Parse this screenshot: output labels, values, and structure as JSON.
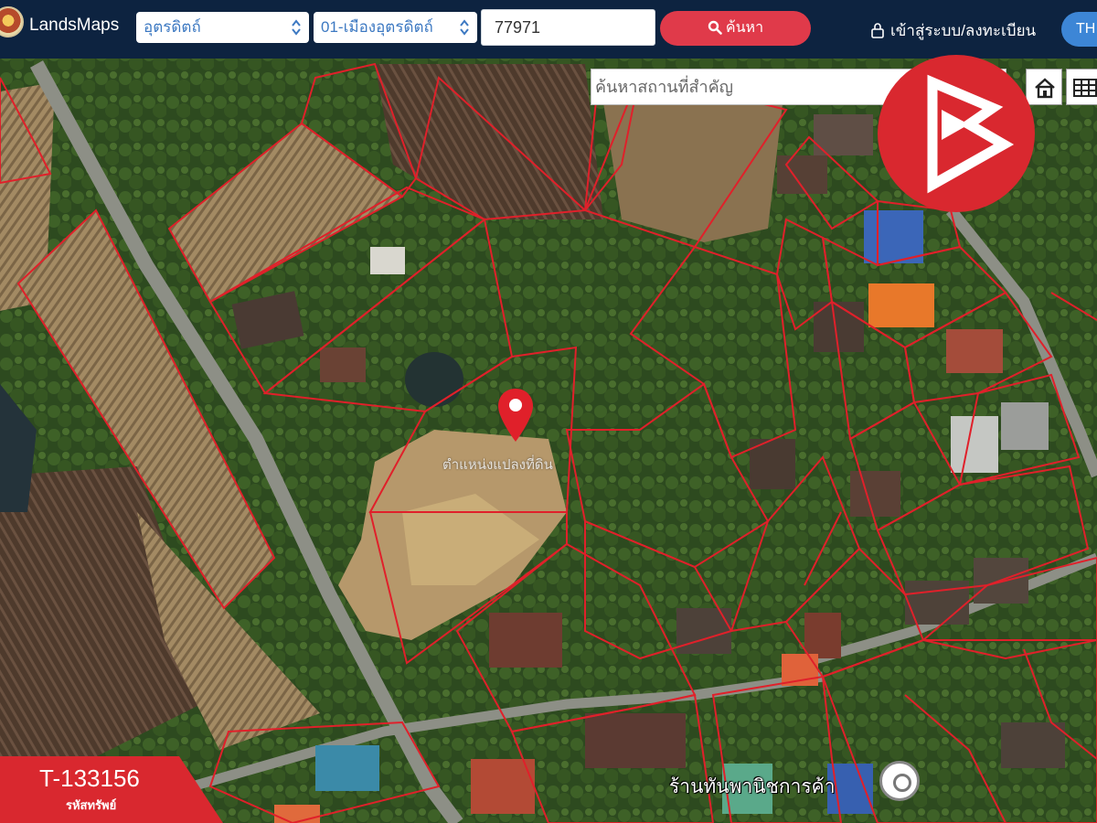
{
  "header": {
    "app_name": "LandsMaps",
    "province": "อุตรดิตถ์",
    "district": "01-เมืองอุตรดิตถ์",
    "parcel_number": "77971",
    "search_label": "ค้นหา",
    "login_label": "เข้าสู่ระบบ/ลงทะเบียน",
    "language": "TH"
  },
  "map": {
    "place_search_placeholder": "ค้นหาสถานที่สำคัญ",
    "clear_symbol": "×",
    "pin_label": "ตำแหน่งแปลงที่ดิน",
    "shop_label": "ร้านทันพานิชการค้า",
    "parcel_line_color": "#e0202a",
    "pin_color": "#e0202a"
  },
  "listing": {
    "code": "T-133156",
    "code_caption": "รหัสทรัพย์",
    "badge_color": "#d9282f"
  },
  "icons": [
    "search-icon",
    "lock-icon",
    "home-icon",
    "grid-icon",
    "location-pin-icon",
    "brand-logo-icon",
    "place-icon"
  ]
}
